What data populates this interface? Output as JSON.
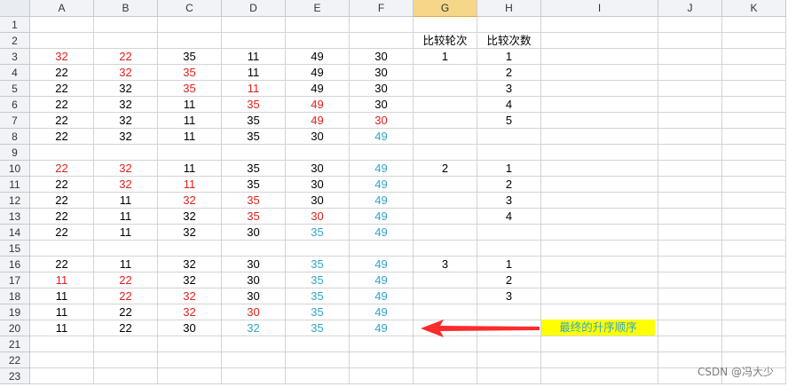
{
  "columns": [
    "A",
    "B",
    "C",
    "D",
    "E",
    "F",
    "G",
    "H",
    "I",
    "J",
    "K"
  ],
  "selected_column": "G",
  "rows": [
    "1",
    "2",
    "3",
    "4",
    "5",
    "6",
    "7",
    "8",
    "9",
    "10",
    "11",
    "12",
    "13",
    "14",
    "15",
    "16",
    "17",
    "18",
    "19",
    "20",
    "21",
    "22",
    "23"
  ],
  "cells": [
    {
      "r": 2,
      "c": "G",
      "v": "比较轮次"
    },
    {
      "r": 2,
      "c": "H",
      "v": "比较次数"
    },
    {
      "r": 3,
      "c": "A",
      "v": "32",
      "color": "red"
    },
    {
      "r": 3,
      "c": "B",
      "v": "22",
      "color": "red"
    },
    {
      "r": 3,
      "c": "C",
      "v": "35"
    },
    {
      "r": 3,
      "c": "D",
      "v": "11"
    },
    {
      "r": 3,
      "c": "E",
      "v": "49"
    },
    {
      "r": 3,
      "c": "F",
      "v": "30"
    },
    {
      "r": 3,
      "c": "G",
      "v": "1"
    },
    {
      "r": 3,
      "c": "H",
      "v": "1"
    },
    {
      "r": 4,
      "c": "A",
      "v": "22"
    },
    {
      "r": 4,
      "c": "B",
      "v": "32",
      "color": "red"
    },
    {
      "r": 4,
      "c": "C",
      "v": "35",
      "color": "red"
    },
    {
      "r": 4,
      "c": "D",
      "v": "11"
    },
    {
      "r": 4,
      "c": "E",
      "v": "49"
    },
    {
      "r": 4,
      "c": "F",
      "v": "30"
    },
    {
      "r": 4,
      "c": "H",
      "v": "2"
    },
    {
      "r": 5,
      "c": "A",
      "v": "22"
    },
    {
      "r": 5,
      "c": "B",
      "v": "32"
    },
    {
      "r": 5,
      "c": "C",
      "v": "35",
      "color": "red"
    },
    {
      "r": 5,
      "c": "D",
      "v": "11",
      "color": "red"
    },
    {
      "r": 5,
      "c": "E",
      "v": "49"
    },
    {
      "r": 5,
      "c": "F",
      "v": "30"
    },
    {
      "r": 5,
      "c": "H",
      "v": "3"
    },
    {
      "r": 6,
      "c": "A",
      "v": "22"
    },
    {
      "r": 6,
      "c": "B",
      "v": "32"
    },
    {
      "r": 6,
      "c": "C",
      "v": "11"
    },
    {
      "r": 6,
      "c": "D",
      "v": "35",
      "color": "red"
    },
    {
      "r": 6,
      "c": "E",
      "v": "49",
      "color": "red"
    },
    {
      "r": 6,
      "c": "F",
      "v": "30"
    },
    {
      "r": 6,
      "c": "H",
      "v": "4"
    },
    {
      "r": 7,
      "c": "A",
      "v": "22"
    },
    {
      "r": 7,
      "c": "B",
      "v": "32"
    },
    {
      "r": 7,
      "c": "C",
      "v": "11"
    },
    {
      "r": 7,
      "c": "D",
      "v": "35"
    },
    {
      "r": 7,
      "c": "E",
      "v": "49",
      "color": "red"
    },
    {
      "r": 7,
      "c": "F",
      "v": "30",
      "color": "red"
    },
    {
      "r": 7,
      "c": "H",
      "v": "5"
    },
    {
      "r": 8,
      "c": "A",
      "v": "22"
    },
    {
      "r": 8,
      "c": "B",
      "v": "32"
    },
    {
      "r": 8,
      "c": "C",
      "v": "11"
    },
    {
      "r": 8,
      "c": "D",
      "v": "35"
    },
    {
      "r": 8,
      "c": "E",
      "v": "30"
    },
    {
      "r": 8,
      "c": "F",
      "v": "49",
      "color": "teal"
    },
    {
      "r": 10,
      "c": "A",
      "v": "22",
      "color": "red"
    },
    {
      "r": 10,
      "c": "B",
      "v": "32",
      "color": "red"
    },
    {
      "r": 10,
      "c": "C",
      "v": "11"
    },
    {
      "r": 10,
      "c": "D",
      "v": "35"
    },
    {
      "r": 10,
      "c": "E",
      "v": "30"
    },
    {
      "r": 10,
      "c": "F",
      "v": "49",
      "color": "teal"
    },
    {
      "r": 10,
      "c": "G",
      "v": "2"
    },
    {
      "r": 10,
      "c": "H",
      "v": "1"
    },
    {
      "r": 11,
      "c": "A",
      "v": "22"
    },
    {
      "r": 11,
      "c": "B",
      "v": "32",
      "color": "red"
    },
    {
      "r": 11,
      "c": "C",
      "v": "11",
      "color": "red"
    },
    {
      "r": 11,
      "c": "D",
      "v": "35"
    },
    {
      "r": 11,
      "c": "E",
      "v": "30"
    },
    {
      "r": 11,
      "c": "F",
      "v": "49",
      "color": "teal"
    },
    {
      "r": 11,
      "c": "H",
      "v": "2"
    },
    {
      "r": 12,
      "c": "A",
      "v": "22"
    },
    {
      "r": 12,
      "c": "B",
      "v": "11"
    },
    {
      "r": 12,
      "c": "C",
      "v": "32",
      "color": "red"
    },
    {
      "r": 12,
      "c": "D",
      "v": "35",
      "color": "red"
    },
    {
      "r": 12,
      "c": "E",
      "v": "30"
    },
    {
      "r": 12,
      "c": "F",
      "v": "49",
      "color": "teal"
    },
    {
      "r": 12,
      "c": "H",
      "v": "3"
    },
    {
      "r": 13,
      "c": "A",
      "v": "22"
    },
    {
      "r": 13,
      "c": "B",
      "v": "11"
    },
    {
      "r": 13,
      "c": "C",
      "v": "32"
    },
    {
      "r": 13,
      "c": "D",
      "v": "35",
      "color": "red"
    },
    {
      "r": 13,
      "c": "E",
      "v": "30",
      "color": "red"
    },
    {
      "r": 13,
      "c": "F",
      "v": "49",
      "color": "teal"
    },
    {
      "r": 13,
      "c": "H",
      "v": "4"
    },
    {
      "r": 14,
      "c": "A",
      "v": "22"
    },
    {
      "r": 14,
      "c": "B",
      "v": "11"
    },
    {
      "r": 14,
      "c": "C",
      "v": "32"
    },
    {
      "r": 14,
      "c": "D",
      "v": "30"
    },
    {
      "r": 14,
      "c": "E",
      "v": "35",
      "color": "teal"
    },
    {
      "r": 14,
      "c": "F",
      "v": "49",
      "color": "teal"
    },
    {
      "r": 16,
      "c": "A",
      "v": "22"
    },
    {
      "r": 16,
      "c": "B",
      "v": "11"
    },
    {
      "r": 16,
      "c": "C",
      "v": "32"
    },
    {
      "r": 16,
      "c": "D",
      "v": "30"
    },
    {
      "r": 16,
      "c": "E",
      "v": "35",
      "color": "teal"
    },
    {
      "r": 16,
      "c": "F",
      "v": "49",
      "color": "teal"
    },
    {
      "r": 16,
      "c": "G",
      "v": "3"
    },
    {
      "r": 16,
      "c": "H",
      "v": "1"
    },
    {
      "r": 17,
      "c": "A",
      "v": "11",
      "color": "red"
    },
    {
      "r": 17,
      "c": "B",
      "v": "22",
      "color": "red"
    },
    {
      "r": 17,
      "c": "C",
      "v": "32"
    },
    {
      "r": 17,
      "c": "D",
      "v": "30"
    },
    {
      "r": 17,
      "c": "E",
      "v": "35",
      "color": "teal"
    },
    {
      "r": 17,
      "c": "F",
      "v": "49",
      "color": "teal"
    },
    {
      "r": 17,
      "c": "H",
      "v": "2"
    },
    {
      "r": 18,
      "c": "A",
      "v": "11"
    },
    {
      "r": 18,
      "c": "B",
      "v": "22",
      "color": "red"
    },
    {
      "r": 18,
      "c": "C",
      "v": "32",
      "color": "red"
    },
    {
      "r": 18,
      "c": "D",
      "v": "30"
    },
    {
      "r": 18,
      "c": "E",
      "v": "35",
      "color": "teal"
    },
    {
      "r": 18,
      "c": "F",
      "v": "49",
      "color": "teal"
    },
    {
      "r": 18,
      "c": "H",
      "v": "3"
    },
    {
      "r": 19,
      "c": "A",
      "v": "11"
    },
    {
      "r": 19,
      "c": "B",
      "v": "22"
    },
    {
      "r": 19,
      "c": "C",
      "v": "32",
      "color": "red"
    },
    {
      "r": 19,
      "c": "D",
      "v": "30",
      "color": "red"
    },
    {
      "r": 19,
      "c": "E",
      "v": "35",
      "color": "teal"
    },
    {
      "r": 19,
      "c": "F",
      "v": "49",
      "color": "teal"
    },
    {
      "r": 20,
      "c": "A",
      "v": "11"
    },
    {
      "r": 20,
      "c": "B",
      "v": "22"
    },
    {
      "r": 20,
      "c": "C",
      "v": "30"
    },
    {
      "r": 20,
      "c": "D",
      "v": "32",
      "color": "teal"
    },
    {
      "r": 20,
      "c": "E",
      "v": "35",
      "color": "teal"
    },
    {
      "r": 20,
      "c": "F",
      "v": "49",
      "color": "teal"
    }
  ],
  "annotation": {
    "text": "最终的升序顺序"
  },
  "arrow": {
    "icon": "left-arrow-icon",
    "color": "#ff2a2a"
  },
  "watermark": "CSDN @冯大少",
  "colors": {
    "red": "#e0201b",
    "teal": "#31a6c4",
    "highlight": "#ffff00"
  }
}
